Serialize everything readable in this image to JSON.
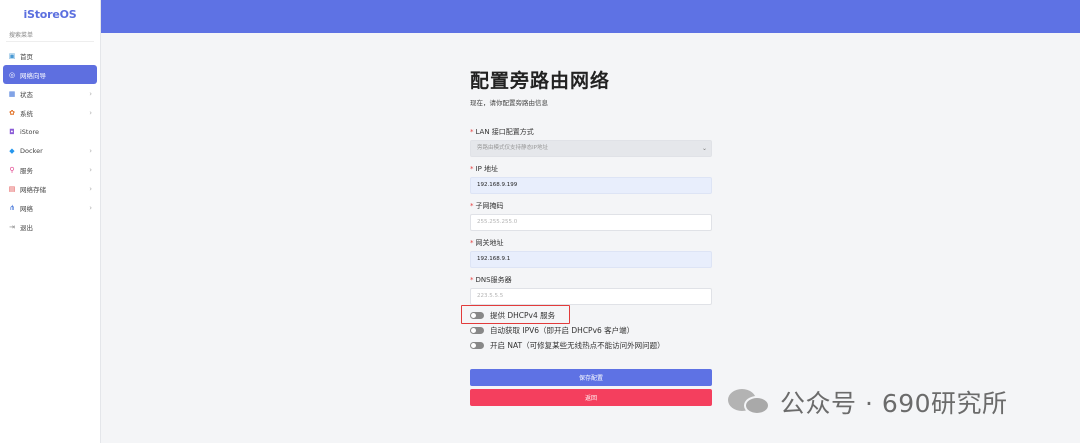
{
  "app": {
    "logo": "iStoreOS"
  },
  "sidebar": {
    "search_label": "搜索菜单",
    "items": [
      {
        "label": "首页",
        "icon": "home-icon",
        "glyph": "▣",
        "has_arrow": false
      },
      {
        "label": "网络向导",
        "icon": "wizard-icon",
        "glyph": "◎",
        "has_arrow": false,
        "active": true
      },
      {
        "label": "状态",
        "icon": "status-icon",
        "glyph": "▦",
        "has_arrow": true
      },
      {
        "label": "系统",
        "icon": "system-icon",
        "glyph": "✿",
        "has_arrow": true
      },
      {
        "label": "iStore",
        "icon": "store-icon",
        "glyph": "◘",
        "has_arrow": false
      },
      {
        "label": "Docker",
        "icon": "docker-icon",
        "glyph": "◆",
        "has_arrow": true
      },
      {
        "label": "服务",
        "icon": "service-icon",
        "glyph": "⚲",
        "has_arrow": true
      },
      {
        "label": "网络存储",
        "icon": "storage-icon",
        "glyph": "▤",
        "has_arrow": true
      },
      {
        "label": "网络",
        "icon": "network-icon",
        "glyph": "⋔",
        "has_arrow": true
      },
      {
        "label": "退出",
        "icon": "logout-icon",
        "glyph": "⇥",
        "has_arrow": false
      }
    ],
    "arrow_glyph": "›"
  },
  "page": {
    "title": "配置旁路由网络",
    "subtitle": "现在，请你配置旁路由信息"
  },
  "form": {
    "required_mark": "*",
    "lan_mode": {
      "label": "LAN 接口配置方式",
      "value": "旁路由模式仅支持静态IP地址"
    },
    "ip": {
      "label": "IP 地址",
      "value": "192.168.9.199"
    },
    "netmask": {
      "label": "子网掩码",
      "placeholder": "255.255.255.0"
    },
    "gateway": {
      "label": "网关地址",
      "value": "192.168.9.1"
    },
    "dns": {
      "label": "DNS服务器",
      "placeholder": "223.5.5.5"
    },
    "toggles": {
      "dhcpv4": {
        "label": "提供 DHCPv4 服务",
        "on": false
      },
      "ipv6": {
        "label": "自动获取 IPV6（即开启 DHCPv6 客户端）",
        "on": false
      },
      "nat": {
        "label": "开启 NAT（可修复某些无线热点不能访问外网问题）",
        "on": false
      }
    },
    "save_label": "保存配置",
    "back_label": "返回"
  },
  "watermark": {
    "text": "公众号 · 690研究所"
  },
  "colors": {
    "accent": "#5e72e4",
    "danger": "#f43f5e",
    "highlight": "#e23b3b"
  }
}
